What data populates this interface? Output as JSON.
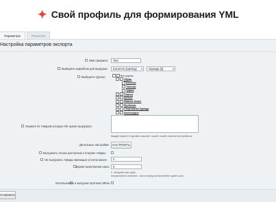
{
  "header": {
    "title": "Свой профиль для формирования YML"
  },
  "tabs": [
    {
      "label": "Параметры"
    },
    {
      "label": "Результат"
    }
  ],
  "section": {
    "title": "Настройка параметров экспорта"
  },
  "fields": {
    "profile_name": {
      "label": "Имя профиля:",
      "value": "Test"
    },
    "infoblock": {
      "label": "Выберите инфоблок для выгрузки:",
      "catalog_value": "Каталоги [catalog]",
      "iblock_value": "Одежда [2]"
    },
    "groups": {
      "label": "Выберите группы:"
    },
    "ids": {
      "label": "Укажите ID товаров которые НЕ нужно выгружать:",
      "hint": "Каждый новый ID отделяйте запятой, точкой, точкой с запятой или пробелом"
    },
    "detail": {
      "label": "Детальные настройки:",
      "button": "НАСТРОИТЬ"
    },
    "only_available": {
      "label": "Выгружать только доступные к покупке товары"
    },
    "min_stock": {
      "label": "Не выгружать товары имеющие остаток менее",
      "value": "0"
    },
    "step_time": {
      "label": "Время выполнения шага:",
      "value": "0",
      "hint1": "0 - выгрузить все сразу",
      "hint2": "положительное значение - число секунд на выполнение одного шага"
    },
    "mbox": {
      "label": "Использовать в выгрузке протокол Mbox"
    }
  },
  "tree": [
    {
      "label": "Все группы",
      "level": 0,
      "bold": false,
      "pm": "−"
    },
    {
      "label": "Обувь",
      "level": 1,
      "bold": true,
      "pm": "−"
    },
    {
      "label": "Балетки",
      "level": 2,
      "bold": true,
      "pm": ""
    },
    {
      "label": "Тапочки",
      "level": 2,
      "bold": true,
      "pm": ""
    },
    {
      "label": "Туфли",
      "level": 2,
      "bold": true,
      "pm": ""
    },
    {
      "label": "Платья",
      "level": 1,
      "bold": true,
      "pm": "+"
    },
    {
      "label": "Штаны",
      "level": 1,
      "bold": true,
      "pm": "+"
    },
    {
      "label": "Нижнее белье",
      "level": 1,
      "bold": true,
      "pm": "+"
    },
    {
      "label": "Футболки",
      "level": 1,
      "bold": true,
      "pm": "+"
    },
    {
      "label": "Спортивная Одежда",
      "level": 1,
      "bold": true,
      "pm": "+"
    },
    {
      "label": "Аксессуары",
      "level": 1,
      "bold": true,
      "pm": "+"
    }
  ],
  "footer": {
    "save_label": "Сохранить"
  },
  "colors": {
    "accent": "#e8463a",
    "panel": "#eef2f4"
  }
}
